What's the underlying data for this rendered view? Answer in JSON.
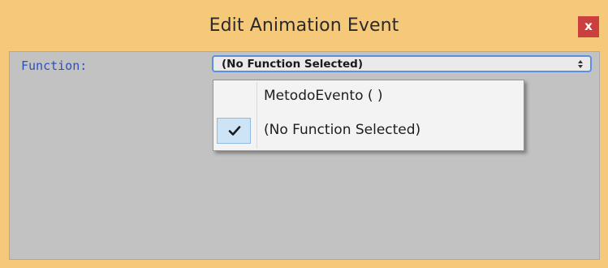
{
  "window": {
    "title": "Edit Animation Event",
    "close_glyph": "x"
  },
  "form": {
    "function_label": "Function:",
    "function_select": {
      "selected": "(No Function Selected)",
      "options": [
        "MetodoEvento ( )",
        "(No Function Selected)"
      ],
      "checked_index": 1
    }
  },
  "colors": {
    "window_frame": "#f6c87a",
    "client_bg": "#c2c2c2",
    "label_blue": "#2b4fbd",
    "close_red": "#cc3f3f",
    "select_border": "#5b8fe0",
    "highlight": "#cde4f7"
  },
  "icons": {
    "close": "close-icon",
    "dropdown": "updown-arrows-icon",
    "checked": "check-icon"
  }
}
